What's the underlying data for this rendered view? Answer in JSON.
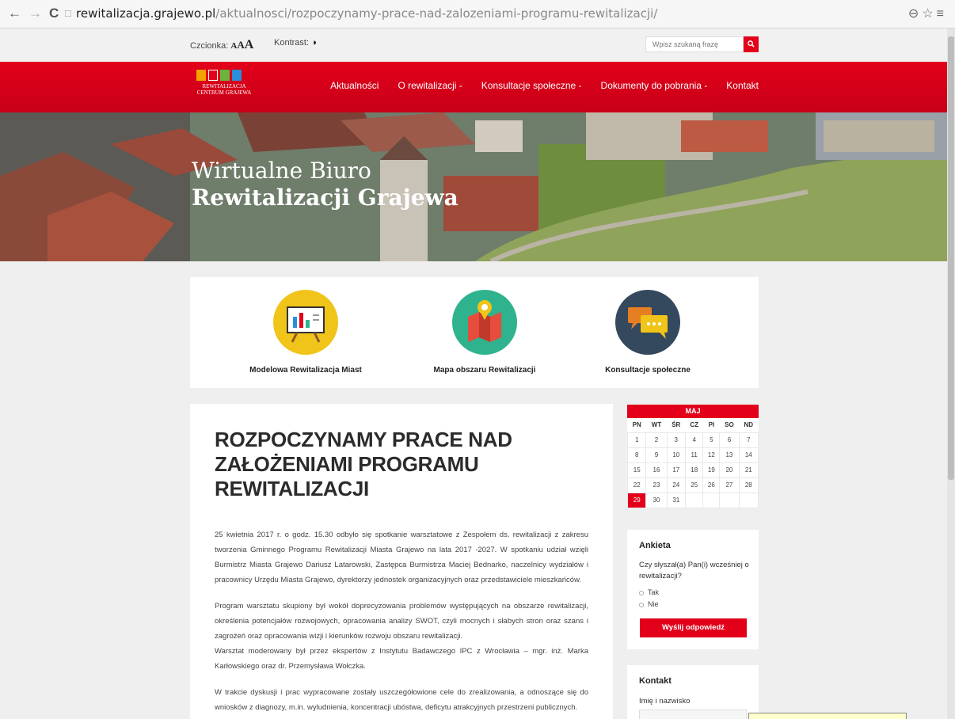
{
  "browser": {
    "back_icon": "←",
    "forward_icon": "→",
    "reload_icon": "C",
    "page_icon": "□",
    "url_host": "rewitalizacja.grajewo.pl",
    "url_path": "/aktualnosci/rozpoczynamy-prace-nad-zalozeniami-programu-rewitalizacji/",
    "right_icons": "⊖☆≡"
  },
  "topbar": {
    "font_label": "Czcionka:",
    "font_a_small": "A",
    "font_a_medium": "A",
    "font_a_large": "A",
    "contrast_label": "Kontrast:",
    "contrast_icon": "◑",
    "search_placeholder": "Wpisz szukaną frazę",
    "search_icon": "🔍"
  },
  "logo": {
    "line1": "REWITALIZACJA",
    "line2": "CENTRUM GRAJEWA",
    "colors": [
      "#f2a300",
      "#e2001a",
      "#6cb33f",
      "#2a8fd8"
    ]
  },
  "nav": {
    "items": [
      "Aktualności",
      "O rewitalizacji -",
      "Konsultacje społeczne -",
      "Dokumenty do pobrania -",
      "Kontakt"
    ]
  },
  "hero": {
    "line1": "Wirtualne Biuro",
    "line2": "Rewitalizacji Grajewa"
  },
  "tiles": [
    {
      "label": "Modelowa Rewitalizacja Miast",
      "color": "#f0c419",
      "icon": "presentation-board-icon"
    },
    {
      "label": "Mapa obszaru Rewitalizacji",
      "color": "#2fb38e",
      "icon": "map-pin-icon"
    },
    {
      "label": "Konsultacje społeczne",
      "color": "#34495e",
      "icon": "chat-bubbles-icon"
    }
  ],
  "article": {
    "title": "ROZPOCZYNAMY PRACE NAD ZAŁOŻENIAMI PROGRAMU REWITALIZACJI",
    "p1": "25 kwietnia 2017 r. o godz. 15.30 odbyło się spotkanie warsztatowe z Zespołem ds. rewitalizacji z zakresu tworzenia Gminnego Programu Rewitalizacji Miasta Grajewo na lata 2017 -2027. W spotkaniu udział wzięli Burmistrz Miasta Grajewo Dariusz Latarowski, Zastępca Burmistrza Maciej Bednarko, naczelnicy wydziałów i pracownicy Urzędu Miasta Grajewo, dyrektorzy jednostek organizacyjnych oraz przedstawiciele mieszkańców.",
    "p2": "Program warsztatu skupiony był wokół doprecyzowania problemów występujących na obszarze rewitalizacji, określenia potencjałów rozwojowych, opracowania analizy SWOT, czyli mocnych i słabych stron oraz szans i zagrożeń oraz opracowania wizji i kierunków rozwoju obszaru rewitalizacji.",
    "p2b": "Warsztat moderowany był przez ekspertów z Instytutu Badawczego IPC z Wrocławia – mgr. inż. Marka Karłowskiego oraz dr. Przemysława Wołczka.",
    "p3": "W trakcie dyskusji i prac wypracowane zostały uszczegółowione cele do zrealizowania, a odnoszące się do wniosków z diagnozy, m.in. wyludnienia, koncentracji ubóstwa, deficytu atrakcyjnych przestrzeni publicznych."
  },
  "calendar": {
    "month": "MAJ",
    "days": [
      "PN",
      "WT",
      "ŚR",
      "CZ",
      "PI",
      "SO",
      "ND"
    ],
    "weeks": [
      [
        "1",
        "2",
        "3",
        "4",
        "5",
        "6",
        "7"
      ],
      [
        "8",
        "9",
        "10",
        "11",
        "12",
        "13",
        "14"
      ],
      [
        "15",
        "16",
        "17",
        "18",
        "19",
        "20",
        "21"
      ],
      [
        "22",
        "23",
        "24",
        "25",
        "26",
        "27",
        "28"
      ],
      [
        "29",
        "30",
        "31",
        "",
        "",
        "",
        ""
      ]
    ],
    "today": "29"
  },
  "poll": {
    "heading": "Ankieta",
    "question": "Czy słyszał(a) Pan(i) wcześniej o rewitalizacji?",
    "options": [
      "Tak",
      "Nie"
    ],
    "submit": "Wyślij odpowiedź"
  },
  "contact": {
    "heading": "Kontakt",
    "name_label": "Imię i nazwisko"
  }
}
